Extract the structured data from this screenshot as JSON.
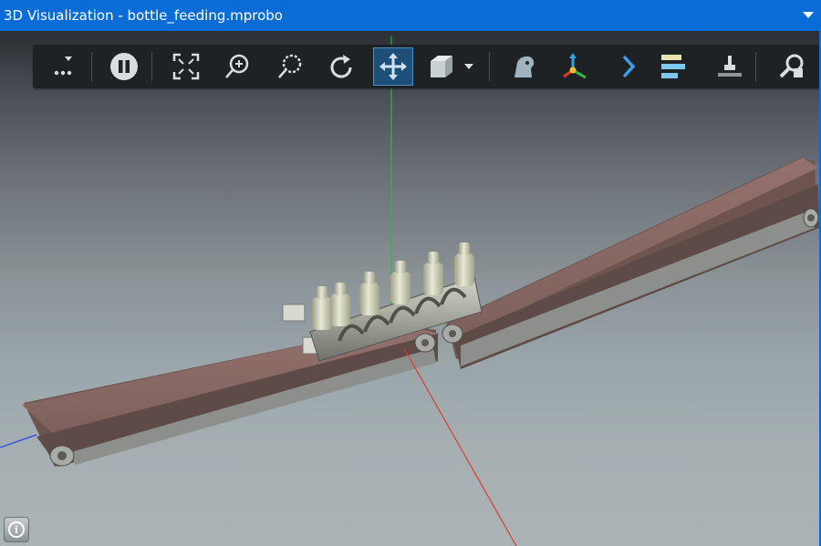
{
  "window": {
    "title": "3D Visualization - bottle_feeding.mprobo",
    "menu_icon": "chevron-down-icon",
    "accent_color": "#0a6cd6"
  },
  "toolbar": {
    "buttons": [
      {
        "name": "more-options",
        "icon": "more-dots-icon"
      },
      {
        "name": "pause-simulation",
        "icon": "pause-icon"
      },
      {
        "name": "fit-to-view",
        "icon": "fit-view-icon"
      },
      {
        "name": "zoom-in",
        "icon": "zoom-in-icon"
      },
      {
        "name": "zoom-window",
        "icon": "zoom-window-icon"
      },
      {
        "name": "rotate-view",
        "icon": "rotate-icon"
      },
      {
        "name": "pan-view",
        "icon": "move-icon",
        "active": true
      },
      {
        "name": "view-cube",
        "icon": "cube-icon"
      },
      {
        "name": "view-dropdown",
        "icon": "dropdown-arrow-icon"
      },
      {
        "name": "robot-display",
        "icon": "robot-head-icon"
      },
      {
        "name": "coordinate-frames",
        "icon": "axes-icon"
      },
      {
        "name": "next-step",
        "icon": "chevron-right-icon"
      },
      {
        "name": "align-bars",
        "icon": "align-bars-icon"
      },
      {
        "name": "floor-plane",
        "icon": "floor-icon"
      },
      {
        "name": "inspect-tool",
        "icon": "inspect-tool-icon"
      }
    ]
  },
  "scene": {
    "axis_colors": {
      "x": "#e03a2a",
      "y": "#2cbb3a",
      "z": "#2a4ae0"
    },
    "belt_color": "#8a6a66",
    "bottle_count": 6
  },
  "info_button": {
    "icon": "info-icon",
    "label": "i"
  }
}
